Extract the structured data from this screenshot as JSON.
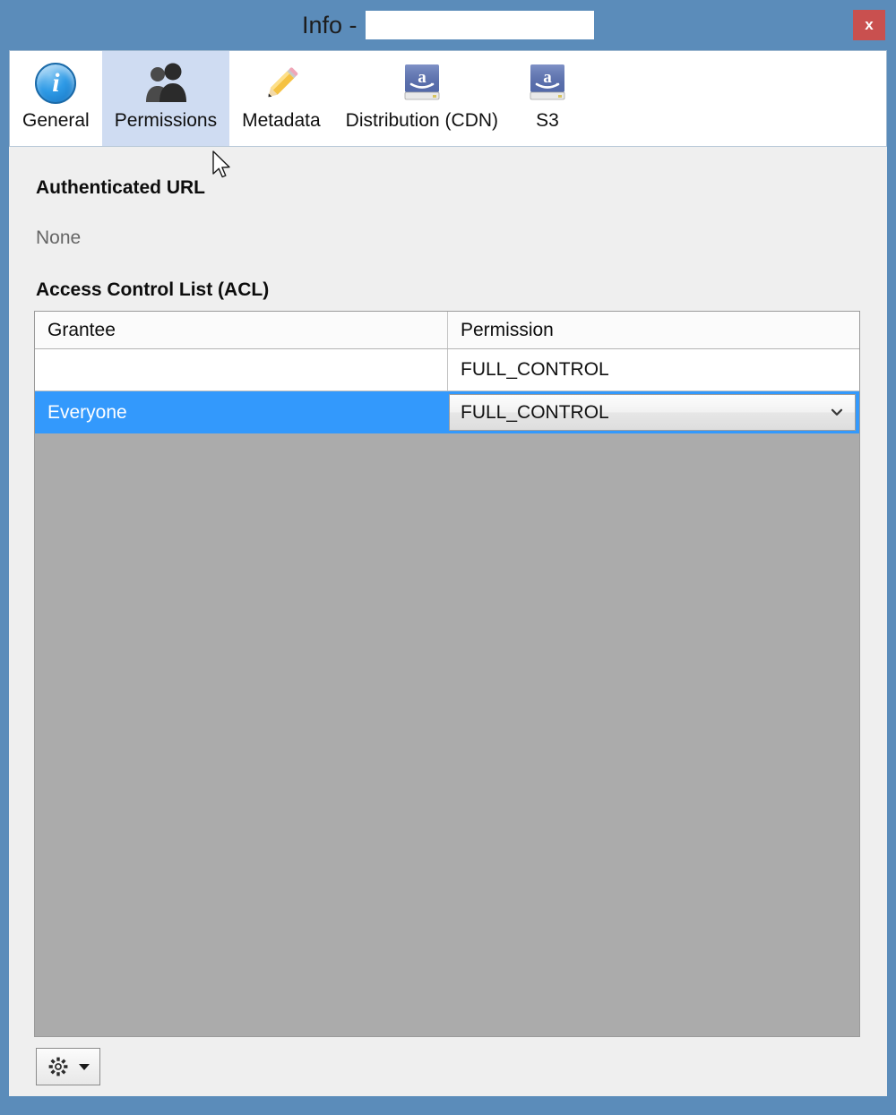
{
  "window": {
    "title_prefix": "Info - ",
    "title_redacted": true,
    "close_label": "x",
    "titlebar_color": "#5b8cba",
    "close_color": "#c9504f"
  },
  "tabs": [
    {
      "id": "general",
      "label": "General",
      "icon": "info-icon",
      "selected": false
    },
    {
      "id": "permissions",
      "label": "Permissions",
      "icon": "people-icon",
      "selected": true
    },
    {
      "id": "metadata",
      "label": "Metadata",
      "icon": "pencil-icon",
      "selected": false
    },
    {
      "id": "distribution",
      "label": "Distribution (CDN)",
      "icon": "amazon-drive-icon",
      "selected": false
    },
    {
      "id": "s3",
      "label": "S3",
      "icon": "amazon-drive-icon",
      "selected": false
    }
  ],
  "panel": {
    "auth_url_title": "Authenticated URL",
    "auth_url_value": "None",
    "acl_title": "Access Control List (ACL)"
  },
  "acl_table": {
    "columns": [
      "Grantee",
      "Permission"
    ],
    "rows": [
      {
        "grantee": "",
        "permission": "FULL_CONTROL",
        "selected": false,
        "editing": false
      },
      {
        "grantee": "Everyone",
        "permission": "FULL_CONTROL",
        "selected": true,
        "editing": true
      }
    ],
    "selected_row_color": "#3399fc",
    "empty_area_color": "#ababab"
  },
  "toolbar": {
    "gear_label": "gear-icon",
    "gear_menu_label": "dropdown-arrow"
  }
}
